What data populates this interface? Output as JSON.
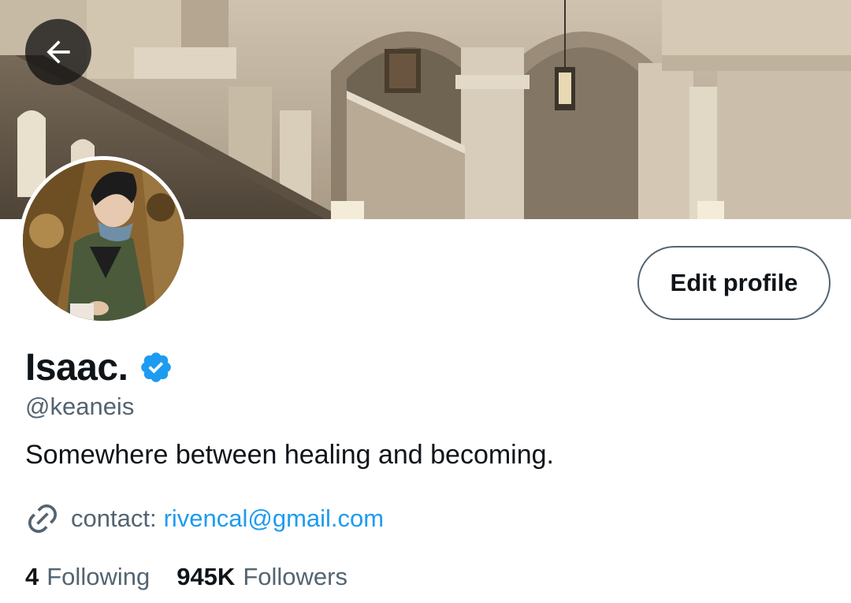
{
  "header": {
    "back_icon": "arrow-left-icon",
    "banner_image": "library-staircase-banner"
  },
  "profile": {
    "avatar": "profile-avatar-photo",
    "edit_button_label": "Edit profile",
    "display_name": "Isaac.",
    "verified_icon": "verified-badge-icon",
    "verified_color": "#1d9bf0",
    "handle": "@keaneis",
    "bio": "Somewhere between healing and becoming.",
    "link": {
      "icon": "link-icon",
      "prefix": "contact:",
      "url_text": "rivencal@gmail.com"
    },
    "stats": {
      "following_count": "4",
      "following_label": "Following",
      "followers_count": "945K",
      "followers_label": "Followers"
    }
  },
  "colors": {
    "text_primary": "#0f1419",
    "text_secondary": "#536471",
    "accent": "#1d9bf0",
    "background": "#ffffff"
  }
}
